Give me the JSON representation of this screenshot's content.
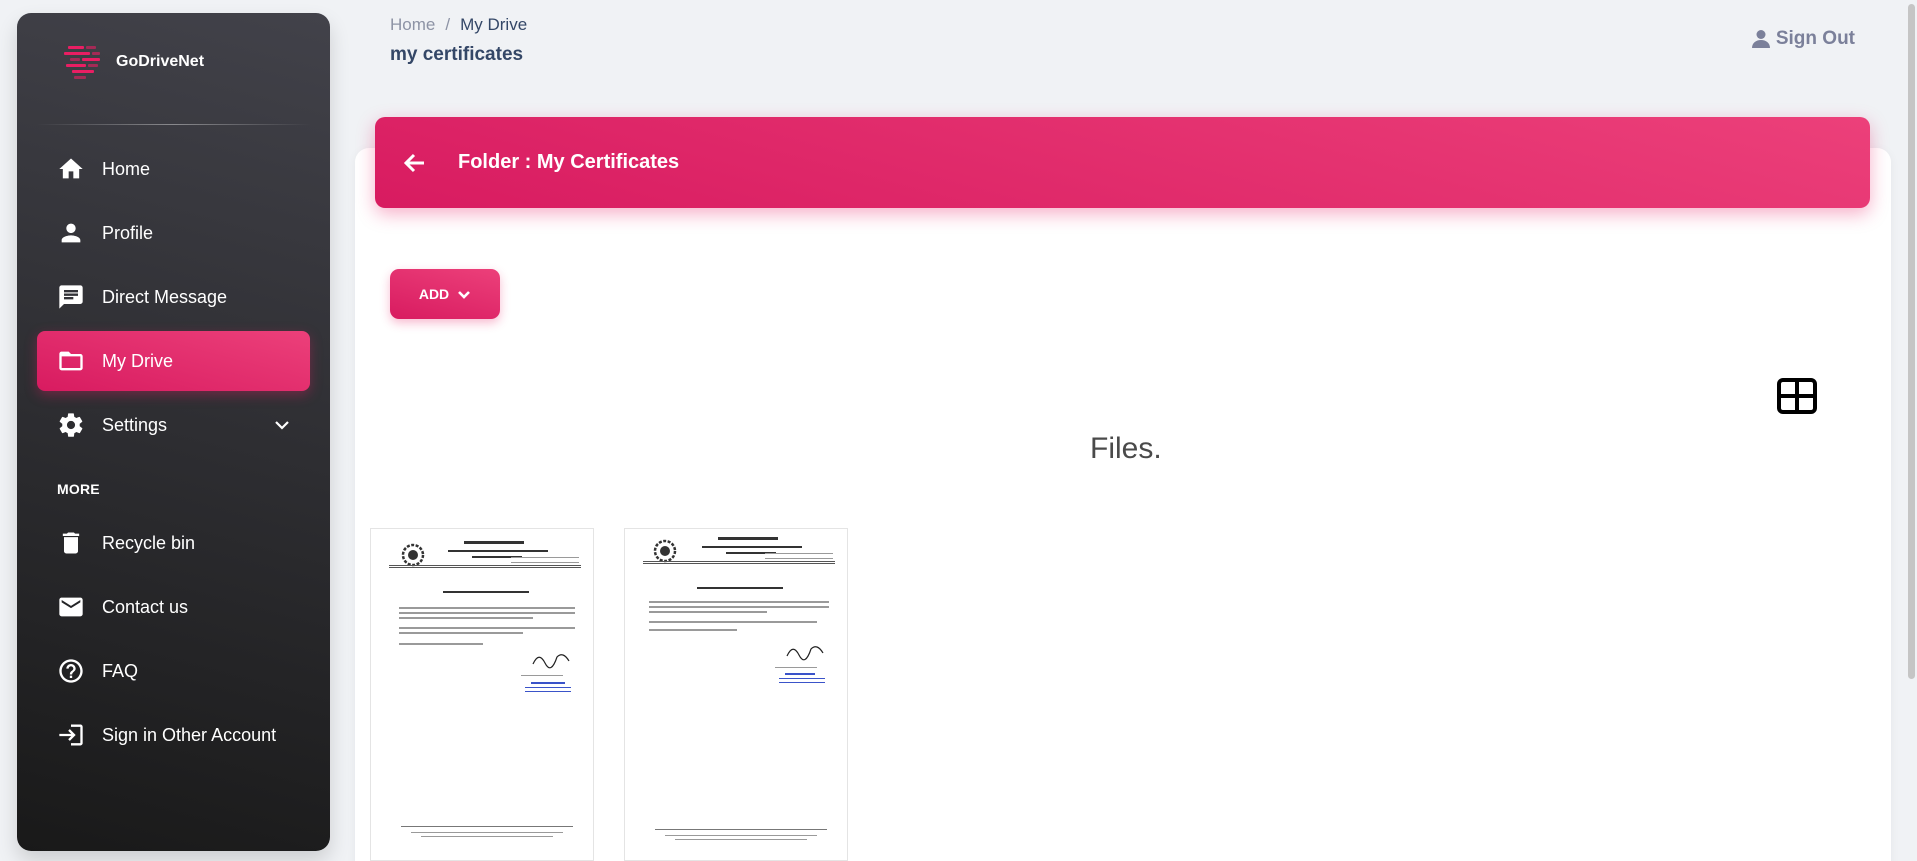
{
  "brand": {
    "name": "GoDriveNet"
  },
  "sidebar": {
    "items": [
      {
        "label": "Home",
        "icon": "home-icon"
      },
      {
        "label": "Profile",
        "icon": "person-icon"
      },
      {
        "label": "Direct Message",
        "icon": "message-icon"
      },
      {
        "label": "My Drive",
        "icon": "folder-icon",
        "active": true
      },
      {
        "label": "Settings",
        "icon": "gear-icon",
        "expandable": true
      }
    ],
    "section_title": "MORE",
    "more_items": [
      {
        "label": "Recycle bin",
        "icon": "trash-icon"
      },
      {
        "label": "Contact us",
        "icon": "mail-icon"
      },
      {
        "label": "FAQ",
        "icon": "help-icon"
      },
      {
        "label": "Sign in Other Account",
        "icon": "login-icon"
      }
    ]
  },
  "header": {
    "breadcrumb": {
      "home": "Home",
      "separator": "/",
      "current": "My Drive"
    },
    "title": "my certificates",
    "signout_label": "Sign Out"
  },
  "folder": {
    "title": "Folder : My Certificates",
    "add_label": "ADD",
    "files_heading": "Files."
  },
  "colors": {
    "accent": "#e91e63",
    "sidebar_dark": "#1f1f22",
    "background": "#f0f2f5"
  }
}
